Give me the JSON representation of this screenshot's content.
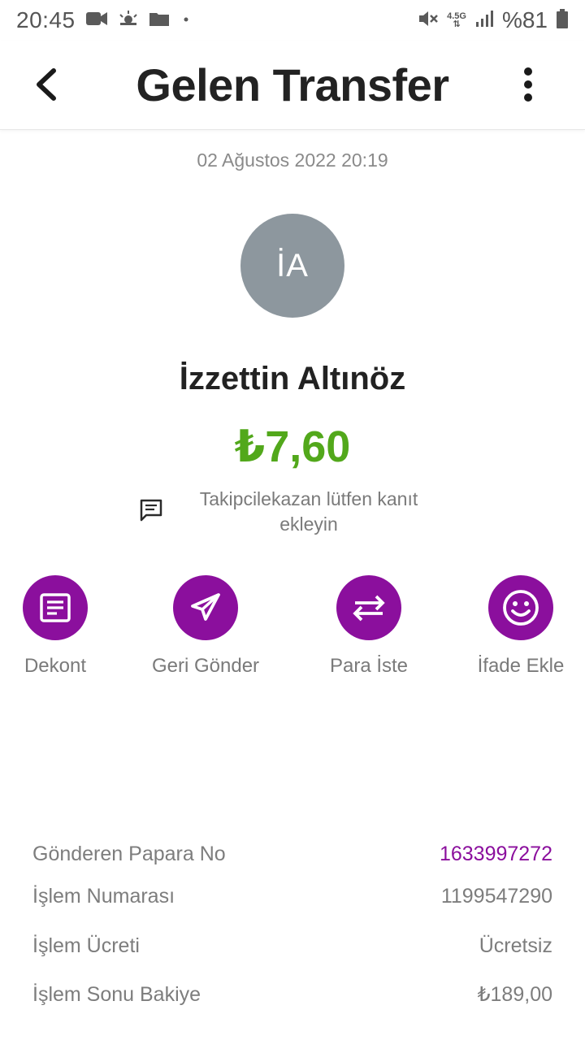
{
  "status_bar": {
    "time": "20:45",
    "network": "4.5G",
    "battery": "%81",
    "icons": [
      "video-icon",
      "weather-icon",
      "folder-icon",
      "dot-icon",
      "mute-icon",
      "signal-icon",
      "battery-icon"
    ]
  },
  "header": {
    "title": "Gelen Transfer"
  },
  "transfer": {
    "date": "02 Ağustos 2022 20:19",
    "avatar_initials": "İA",
    "name": "İzzettin Altınöz",
    "amount": "₺7,60",
    "note": "Takipcilekazan lütfen kanıt ekleyin"
  },
  "actions": [
    {
      "label": "Dekont",
      "icon": "receipt-icon"
    },
    {
      "label": "Geri Gönder",
      "icon": "send-icon"
    },
    {
      "label": "Para İste",
      "icon": "swap-icon"
    },
    {
      "label": "İfade Ekle",
      "icon": "smiley-icon"
    }
  ],
  "details": [
    {
      "label": "Gönderen Papara No",
      "value": "1633997272"
    },
    {
      "label": "İşlem Numarası",
      "value": "1199547290"
    },
    {
      "label": "İşlem Ücreti",
      "value": "Ücretsiz"
    },
    {
      "label": "İşlem Sonu Bakiye",
      "value": "₺189,00"
    }
  ],
  "colors": {
    "accent": "#8b0f9d",
    "amount": "#52a81b",
    "avatar": "#8d979e"
  }
}
